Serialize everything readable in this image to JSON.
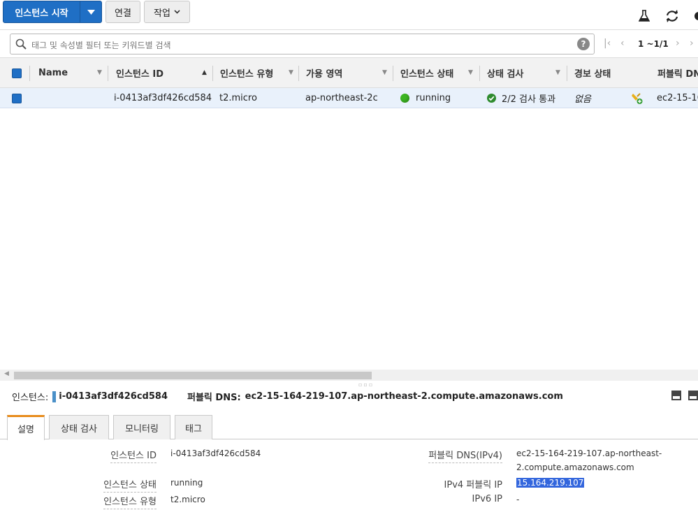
{
  "toolbar": {
    "launch_label": "인스턴스 시작",
    "connect_label": "연결",
    "actions_label": "작업"
  },
  "filter": {
    "placeholder": "태그 및 속성별 필터 또는 키워드별 검색",
    "help": "?",
    "page_range": "1 ~1/1"
  },
  "table": {
    "columns": [
      "Name",
      "인스턴스 ID",
      "인스턴스 유형",
      "가용 영역",
      "인스턴스 상태",
      "상태 검사",
      "경보 상태",
      "퍼블릭 DN"
    ],
    "rows": [
      {
        "name": "",
        "instance_id": "i-0413af3df426cd584",
        "type": "t2.micro",
        "az": "ap-northeast-2c",
        "state": "running",
        "checks": "2/2 검사 통과",
        "alarm": "없음",
        "public_dns": "ec2-15-16"
      }
    ]
  },
  "details": {
    "instance_label": "인스턴스:",
    "instance_id": "i-0413af3df426cd584",
    "dns_label": "퍼블릭 DNS:",
    "dns_value": "ec2-15-164-219-107.ap-northeast-2.compute.amazonaws.com",
    "tabs": [
      "설명",
      "상태 검사",
      "모니터링",
      "태그"
    ],
    "left": [
      {
        "label": "인스턴스 ID",
        "value": "i-0413af3df426cd584"
      },
      {
        "label": "인스턴스 상태",
        "value": "running"
      },
      {
        "label": "인스턴스 유형",
        "value": "t2.micro"
      }
    ],
    "right": [
      {
        "label": "퍼블릭 DNS(IPv4)",
        "value_line1": "ec2-15-164-219-107.ap-northeast-",
        "value_line2": "2.compute.amazonaws.com"
      },
      {
        "label": "IPv4 퍼블릭 IP",
        "value": "15.164.219.107"
      },
      {
        "label": "IPv6 IP",
        "value": "-"
      }
    ]
  },
  "colors": {
    "primary": "#1f6fc5",
    "running": "#3cb521",
    "active_tab": "#e88b1a"
  }
}
